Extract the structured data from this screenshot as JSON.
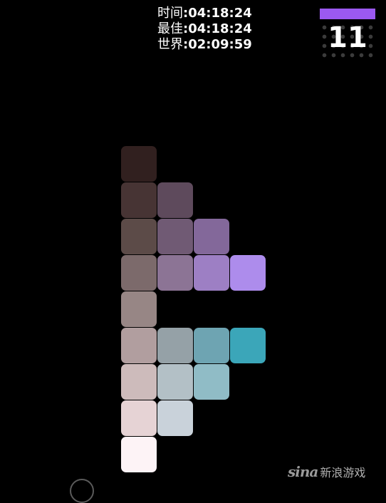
{
  "stats": {
    "time_label": "时间",
    "time_value": ":04:18:24",
    "best_label": "最佳",
    "best_value": ":04:18:24",
    "world_label": "世界",
    "world_value": ":02:09:59"
  },
  "level": {
    "number": "11",
    "bar_color": "#9b59f0"
  },
  "tiles": [
    {
      "col": 0,
      "row": 0,
      "color": "#31201f"
    },
    {
      "col": 0,
      "row": 1,
      "color": "#473434"
    },
    {
      "col": 1,
      "row": 1,
      "color": "#5e4a5c"
    },
    {
      "col": 0,
      "row": 2,
      "color": "#5c4b48"
    },
    {
      "col": 1,
      "row": 2,
      "color": "#705a74"
    },
    {
      "col": 2,
      "row": 2,
      "color": "#83689a"
    },
    {
      "col": 0,
      "row": 3,
      "color": "#7c6a6b"
    },
    {
      "col": 1,
      "row": 3,
      "color": "#8c7495"
    },
    {
      "col": 2,
      "row": 3,
      "color": "#9d7fc4"
    },
    {
      "col": 3,
      "row": 3,
      "color": "#ad8cec"
    },
    {
      "col": 0,
      "row": 4,
      "color": "#978685"
    },
    {
      "col": 0,
      "row": 5,
      "color": "#b19e9f"
    },
    {
      "col": 1,
      "row": 5,
      "color": "#95a1a7"
    },
    {
      "col": 2,
      "row": 5,
      "color": "#6ea4b2"
    },
    {
      "col": 3,
      "row": 5,
      "color": "#3ba6b9"
    },
    {
      "col": 0,
      "row": 6,
      "color": "#cdbbbb"
    },
    {
      "col": 1,
      "row": 6,
      "color": "#b3c0c6"
    },
    {
      "col": 2,
      "row": 6,
      "color": "#90bcc6"
    },
    {
      "col": 0,
      "row": 7,
      "color": "#e6d3d5"
    },
    {
      "col": 1,
      "row": 7,
      "color": "#c9d2da"
    },
    {
      "col": 0,
      "row": 8,
      "color": "#fdf3f6"
    }
  ],
  "logo": {
    "mark": "sina",
    "text": "新浪游戏"
  }
}
